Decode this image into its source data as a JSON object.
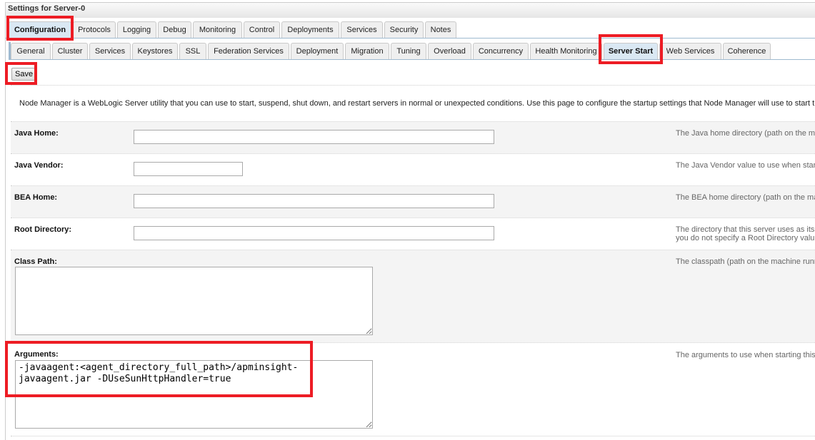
{
  "title": "Settings for Server-0",
  "main_tabs": [
    "Configuration",
    "Protocols",
    "Logging",
    "Debug",
    "Monitoring",
    "Control",
    "Deployments",
    "Services",
    "Security",
    "Notes"
  ],
  "active_main_tab": "Configuration",
  "sub_tabs": [
    "General",
    "Cluster",
    "Services",
    "Keystores",
    "SSL",
    "Federation Services",
    "Deployment",
    "Migration",
    "Tuning",
    "Overload",
    "Concurrency",
    "Health Monitoring",
    "Server Start",
    "Web Services",
    "Coherence"
  ],
  "active_sub_tab": "Server Start",
  "save_label": "Save",
  "intro": "Node Manager is a WebLogic Server utility that you can use to start, suspend, shut down, and restart servers in normal or unexpected conditions. Use this page to configure the startup settings that Node Manager will use to start t",
  "fields": {
    "java_home": {
      "label": "Java Home:",
      "value": "",
      "help": "The Java home directory (path on the m"
    },
    "java_vendor": {
      "label": "Java Vendor:",
      "value": "",
      "help": "The Java Vendor value to use when star"
    },
    "bea_home": {
      "label": "BEA Home:",
      "value": "",
      "help": "The BEA home directory (path on the ma"
    },
    "root_directory": {
      "label": "Root Directory:",
      "value": "",
      "help": "The directory that this server uses as its",
      "help2": "you do not specify a Root Directory valu"
    },
    "class_path": {
      "label": "Class Path:",
      "value": "",
      "help": "The classpath (path on the machine runn"
    },
    "arguments": {
      "label": "Arguments:",
      "value": "-javaagent:<agent_directory_full_path>/apminsight-javaagent.jar -DUseSunHttpHandler=true",
      "help": "The arguments to use when starting this"
    }
  },
  "highlight_color": "#ed1c24"
}
